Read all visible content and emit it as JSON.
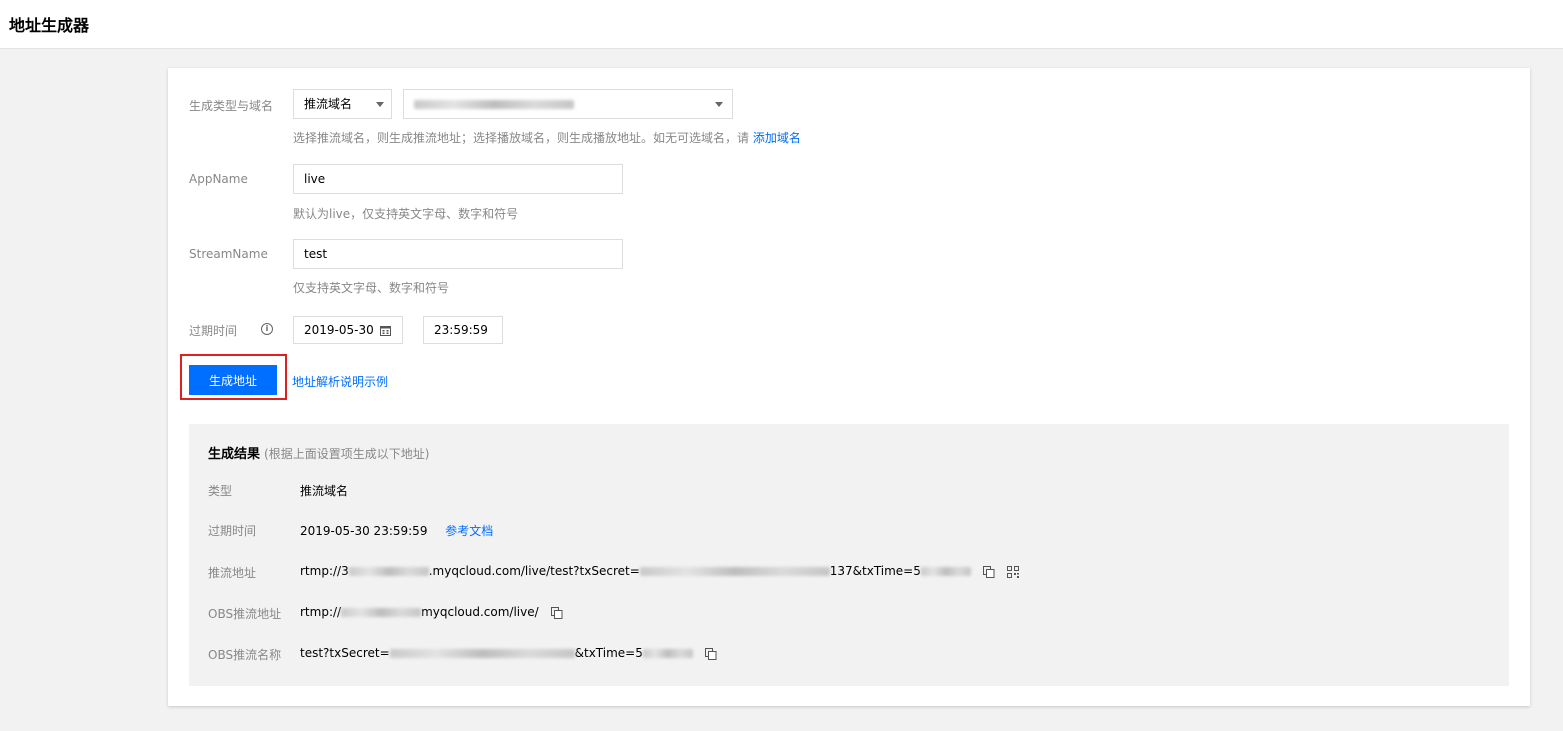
{
  "page": {
    "title": "地址生成器"
  },
  "form": {
    "type_label": "生成类型与域名",
    "type_select": "推流域名",
    "type_hint_prefix": "选择推流域名，则生成推流地址；选择播放域名，则生成播放地址。如无可选域名，请",
    "type_hint_link": "添加域名",
    "appname_label": "AppName",
    "appname_value": "live",
    "appname_hint": "默认为live，仅支持英文字母、数字和符号",
    "stream_label": "StreamName",
    "stream_value": "test",
    "stream_hint": "仅支持英文字母、数字和符号",
    "expire_label": "过期时间",
    "expire_date": "2019-05-30",
    "expire_time": "23:59:59",
    "generate_button": "生成地址",
    "example_link": "地址解析说明示例"
  },
  "result": {
    "title": "生成结果",
    "subtitle": "(根据上面设置项生成以下地址)",
    "type_label": "类型",
    "type_value": "推流域名",
    "expire_label": "过期时间",
    "expire_value": "2019-05-30 23:59:59",
    "doc_link": "参考文档",
    "push_label": "推流地址",
    "push_part1": "rtmp://3",
    "push_part2": ".myqcloud.com/live/test?txSecret=",
    "push_part3": "137&txTime=5",
    "obs_url_label": "OBS推流地址",
    "obs_url_part1": "rtmp://",
    "obs_url_part2": "myqcloud.com/live/",
    "obs_name_label": "OBS推流名称",
    "obs_name_part1": "test?txSecret=",
    "obs_name_part2": "&txTime=5"
  },
  "icons": {
    "dropdown": "chevron-down-icon",
    "calendar": "calendar-icon",
    "info": "info-icon",
    "copy": "copy-icon",
    "qrcode": "qrcode-icon"
  },
  "colors": {
    "primary": "#006eff",
    "highlight": "#e02020"
  }
}
